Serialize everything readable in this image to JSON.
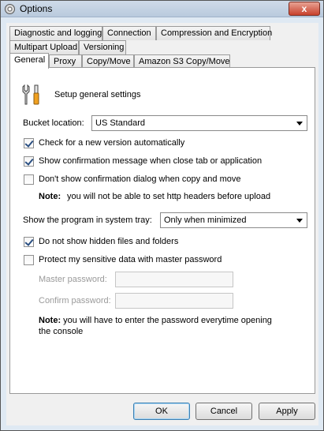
{
  "window": {
    "title": "Options",
    "close_symbol": "x"
  },
  "tabs": {
    "row1": [
      "Diagnostic and logging",
      "Connection",
      "Compression and Encryption"
    ],
    "row2": [
      "Multipart Upload",
      "Versioning"
    ],
    "row3": [
      "General",
      "Proxy",
      "Copy/Move",
      "Amazon S3 Copy/Move"
    ],
    "active": "General"
  },
  "general": {
    "header": "Setup general settings",
    "bucket_location_label": "Bucket location:",
    "bucket_location_value": "US Standard",
    "checks": [
      {
        "label": "Check for a new version automatically",
        "checked": true
      },
      {
        "label": "Show confirmation message when close tab or application",
        "checked": true
      },
      {
        "label": "Don't show confirmation dialog when copy and move",
        "checked": false
      }
    ],
    "note1_bold": "Note:",
    "note1_text": "you will not be able to set http headers before upload",
    "tray_label": "Show the program in system tray:",
    "tray_value": "Only when minimized",
    "hidden_files": {
      "label": "Do not show hidden files and folders",
      "checked": true
    },
    "protect": {
      "label": "Protect my sensitive data with master password",
      "checked": false
    },
    "master_password_label": "Master password:",
    "master_password_value": "",
    "confirm_password_label": "Confirm password:",
    "confirm_password_value": "",
    "note2_bold": "Note:",
    "note2_text": "you will have to enter the password everytime opening the console"
  },
  "buttons": {
    "ok": "OK",
    "cancel": "Cancel",
    "apply": "Apply"
  }
}
